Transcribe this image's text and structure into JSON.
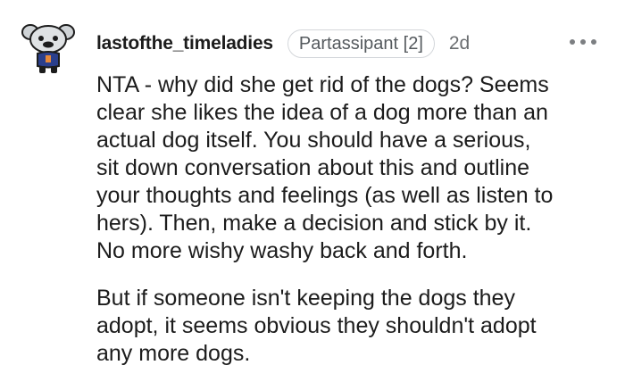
{
  "comment": {
    "username": "lastofthe_timeladies",
    "flair": "Partassipant [2]",
    "age": "2d",
    "avatar_icon": "snoo-avatar-icon",
    "more_icon": "more-options-icon",
    "paragraphs": [
      "NTA - why did she get rid of the dogs? Seems\nclear she likes the idea of a dog more than an\nactual dog itself. You should have a serious,\nsit down conversation about this and outline\nyour thoughts and feelings (as well as listen to\nhers). Then, make a decision and stick by it.\nNo more wishy washy back and forth.",
      "But if someone isn't keeping the dogs they\nadopt, it seems obvious they shouldn't adopt\nany more dogs."
    ]
  },
  "colors": {
    "text": "#1c1c1c",
    "meta": "#6a6d70",
    "flair_border": "#d3d6da"
  }
}
